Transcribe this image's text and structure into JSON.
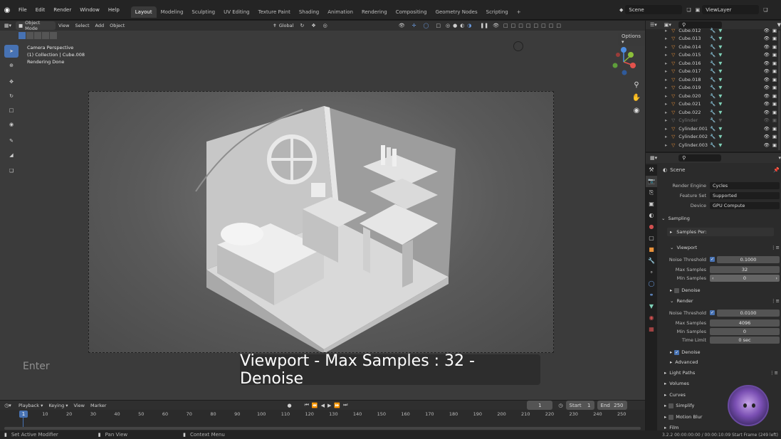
{
  "topbar": {
    "menus": [
      "File",
      "Edit",
      "Render",
      "Window",
      "Help"
    ],
    "workspaces": [
      "Layout",
      "Modeling",
      "Sculpting",
      "UV Editing",
      "Texture Paint",
      "Shading",
      "Animation",
      "Rendering",
      "Compositing",
      "Geometry Nodes",
      "Scripting"
    ],
    "active_workspace": "Layout",
    "add_tab": "+",
    "scene": "Scene",
    "view_layer": "ViewLayer"
  },
  "viewport": {
    "mode": "Object Mode",
    "menus": [
      "View",
      "Select",
      "Add",
      "Object"
    ],
    "transform_orientation": "Global",
    "options": "Options",
    "overlay_lines": [
      "Camera Perspective",
      "(1) Collection | Cube.008",
      "Rendering Done"
    ],
    "gizmo_axes": [
      "X",
      "Y",
      "Z"
    ]
  },
  "caption": "Viewport - Max Samples : 32 - Denoise",
  "enter_hint": "Enter",
  "timeline": {
    "menus": [
      "Playback",
      "Keying",
      "View",
      "Marker"
    ],
    "current_frame": "1",
    "start_label": "Start",
    "start": "1",
    "end_label": "End",
    "end": "250",
    "ticks": [
      "1",
      "10",
      "20",
      "30",
      "40",
      "50",
      "60",
      "70",
      "80",
      "90",
      "100",
      "110",
      "120",
      "130",
      "140",
      "150",
      "160",
      "170",
      "180",
      "190",
      "200",
      "210",
      "220",
      "230",
      "240",
      "250"
    ]
  },
  "statusbar": {
    "items": [
      "Set Active Modifier",
      "Pan View",
      "Context Menu"
    ],
    "info": "3.2.2  00:00:00:00 / 00:00:10:09  Start Frame (249 left)"
  },
  "outliner": {
    "items": [
      "Cube.012",
      "Cube.013",
      "Cube.014",
      "Cube.015",
      "Cube.016",
      "Cube.017",
      "Cube.018",
      "Cube.019",
      "Cube.020",
      "Cube.021",
      "Cube.022",
      "Cylinder",
      "Cylinder.001",
      "Cylinder.002",
      "Cylinder.003"
    ]
  },
  "properties": {
    "scene_label": "Scene",
    "render_engine_label": "Render Engine",
    "render_engine": "Cycles",
    "feature_set_label": "Feature Set",
    "feature_set": "Supported",
    "device_label": "Device",
    "device": "GPU Compute",
    "sampling": "Sampling",
    "samples_per": "Samples Per:",
    "viewport_panel": "Viewport",
    "vp_noise_label": "Noise Threshold",
    "vp_noise": "0.1000",
    "vp_max_label": "Max Samples",
    "vp_max": "32",
    "vp_min_label": "Min Samples",
    "vp_min": "0",
    "denoise": "Denoise",
    "render_panel": "Render",
    "r_noise_label": "Noise Threshold",
    "r_noise": "0.0100",
    "r_max_label": "Max Samples",
    "r_max": "4096",
    "r_min_label": "Min Samples",
    "r_min": "0",
    "r_time_label": "Time Limit",
    "r_time": "0 sec",
    "r_denoise": "Denoise",
    "advanced": "Advanced",
    "sections": [
      "Light Paths",
      "Volumes",
      "Curves",
      "Simplify",
      "Motion Blur",
      "Film"
    ]
  },
  "colors": {
    "accent": "#4772b3",
    "object_icon": "#e8913a",
    "mesh_icon": "#7fd0b7"
  }
}
